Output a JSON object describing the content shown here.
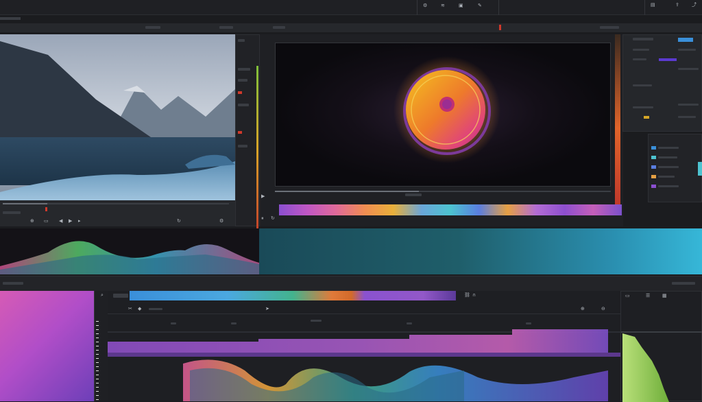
{
  "colors": {
    "accent_orange": "#e0642a",
    "accent_blue": "#3a8fd9",
    "record_red": "#d0392b",
    "panel_bg": "#232428",
    "viewer_bg": "#0b0a0e"
  },
  "top_toolbar": {
    "icons": [
      "gear-icon",
      "equalizer-icon",
      "frame-icon",
      "brush-icon"
    ]
  },
  "source_monitor": {
    "tools": [
      "zoom-icon",
      "fit-icon"
    ],
    "controls": [
      "step-back-icon",
      "play-icon",
      "step-forward-icon",
      "loop-icon",
      "settings-icon"
    ]
  },
  "program_monitor": {
    "controls": [
      "play-icon",
      "pause-icon",
      "loop-icon"
    ]
  },
  "timeline": {
    "tools": [
      "search-icon",
      "link-icon",
      "magnet-icon",
      "scissors-icon",
      "marker-icon",
      "cursor-icon"
    ]
  },
  "right_panel": {
    "tools": [
      "folder-icon",
      "list-icon",
      "grid-icon"
    ]
  }
}
